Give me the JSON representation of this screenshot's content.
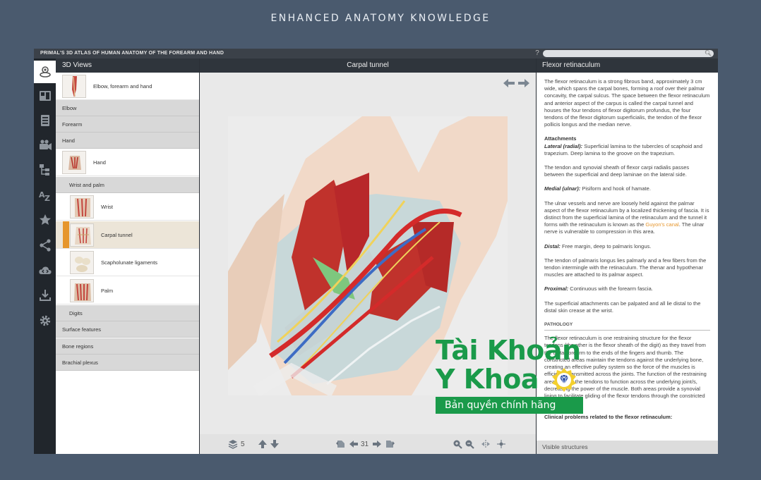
{
  "banner": "ENHANCED ANATOMY KNOWLEDGE",
  "app": {
    "title": "PRIMAL'S 3D ATLAS OF HUMAN ANATOMY OF THE FOREARM AND HAND",
    "help": "?",
    "search_placeholder": ""
  },
  "rail": [
    "model-3d-icon",
    "slides-icon",
    "quiz-icon",
    "movie-icon",
    "hierarchy-icon",
    "a-z-icon",
    "favorites-icon",
    "share-icon",
    "cloud-icon",
    "download-icon",
    "settings-icon"
  ],
  "left": {
    "header": "3D Views",
    "top_item": "Elbow, forearm and hand",
    "elbow": "Elbow",
    "forearm": "Forearm",
    "hand_cat": "Hand",
    "hand_item": "Hand",
    "wrist_palm": "Wrist and palm",
    "wrist": "Wrist",
    "carpal_tunnel": "Carpal tunnel",
    "scapholunate": "Scapholunate ligaments",
    "palm": "Palm",
    "digits": "Digits",
    "surface": "Surface features",
    "bone_regions": "Bone regions",
    "brachial": "Brachial plexus"
  },
  "center": {
    "header": "Carpal tunnel",
    "layers_count": "5",
    "frame_number": "31"
  },
  "right": {
    "header": "Flexor retinaculum",
    "intro": "The flexor retinaculum is a strong fibrous band, approximately 3 cm wide, which spans the carpal bones, forming a roof over their palmar concavity, the carpal sulcus. The space between the flexor retinaculum and anterior aspect of the carpus is called the carpal tunnel and houses the four tendons of flexor digitorum profundus, the four tendons of the flexor digitorum superficialis, the tendon of the flexor pollicis longus and the median nerve.",
    "attachments": "Attachments",
    "lateral_label": "Lateral (radial):",
    "lateral_text": " Superficial lamina to the tubercles of scaphoid and trapezium. Deep lamina to the groove on the trapezium.",
    "tendon_text": "The tendon and synovial sheath of flexor carpi radialis passes between the superficial and deep laminae on the lateral side.",
    "medial_label": "Medial (ulnar):",
    "medial_text": " Pisiform and hook of hamate.",
    "ulnar_text_1": "The ulnar vessels and nerve are loosely held against the palmar aspect of the flexor retinaculum by a localized thickening of fascia. It is distinct from the superficial lamina of the retinaculum and the tunnel it forms with the retinaculum is known as the ",
    "guyons_canal": "Guyon's canal",
    "ulnar_text_2": ". The ulnar nerve is vulnerable to compression in this area.",
    "distal_label": "Distal:",
    "distal_text": " Free margin, deep to palmaris longus.",
    "palmaris_text": "The tendon of palmaris longus lies palmarly and a few fibers from the tendon intermingle with the retinaculum. The thenar and hypothenar muscles are attached to its palmar aspect.",
    "proximal_label": "Proximal:",
    "proximal_text": " Continuous with the forearm fascia.",
    "superficial_text": "The superficial attachments can be palpated and all lie distal to the distal skin crease at the wrist.",
    "pathology": "PATHOLOGY",
    "pathology_text": "The flexor retinaculum is one restraining structure for the flexor tendons (the other is the flexor sheath of the digit) as they travel from the distal forearm to the ends of the fingers and thumb. The constricted areas maintain the tendons against the underlying bone, creating an effective pulley system so the force of the muscles is efficiently transmitted across the joints. The function of the restraining areas allows the tendons to function across the underlying joint/s, decreasing the power of the muscle. Both areas provide a synovial lining to facilitate gliding of the flexor tendons through the constricted area.",
    "clinical": "Clinical problems related to the flexor retinaculum:",
    "visible_structures": "Visible structures"
  },
  "watermark": {
    "line1": "Tài Khoản",
    "line2": "Y Khoa",
    "strip": "Bản quyền chính hãng"
  },
  "colors": {
    "accent": "#e6962c",
    "watermark_green": "#1a9a4a",
    "background": "#4a5a6e"
  }
}
